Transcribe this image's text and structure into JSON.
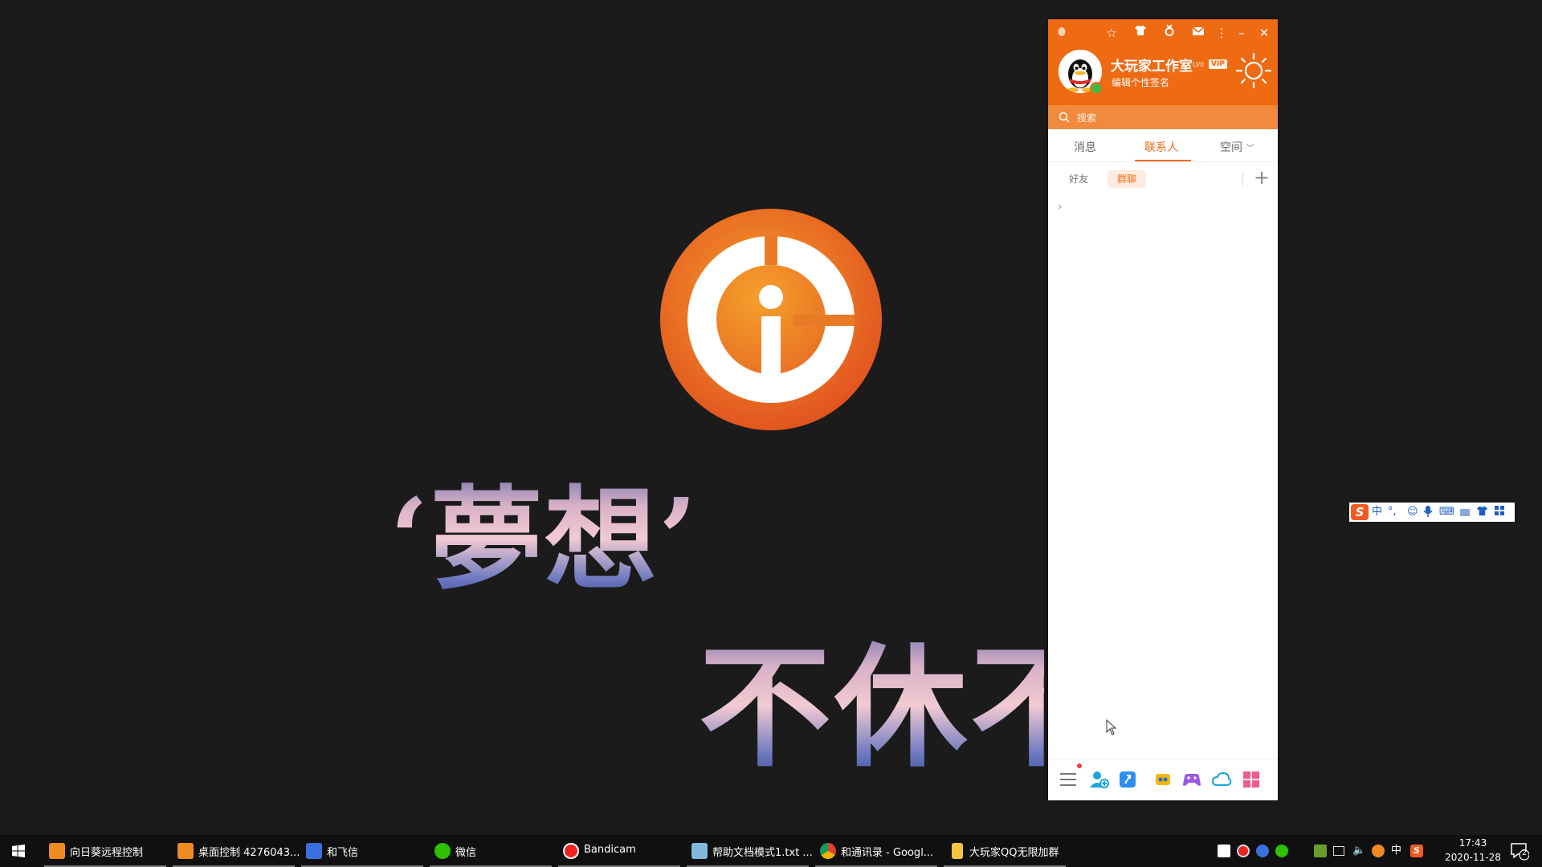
{
  "desktop": {
    "art_line1": "‘夢想’",
    "art_line2": "不休不"
  },
  "qq": {
    "nickname": "大玩家工作室",
    "level": "LV0",
    "vip_badge": "VIP",
    "signature": "编辑个性签名",
    "search_placeholder": "搜索",
    "tabs": [
      {
        "label": "消息"
      },
      {
        "label": "联系人"
      },
      {
        "label": "空间"
      }
    ],
    "subtabs": {
      "friends": "好友",
      "groups": "群聊"
    },
    "accent_color": "#ee6a13"
  },
  "ime": {
    "mode": "中",
    "punct": "°,"
  },
  "taskbar": {
    "items": [
      {
        "label": "向日葵远程控制",
        "icon": "sunflower-icon"
      },
      {
        "label": "桌面控制 4276043...",
        "icon": "sunflower-icon"
      },
      {
        "label": "和飞信",
        "icon": "hefeixin-icon"
      },
      {
        "label": "微信",
        "icon": "wechat-icon"
      },
      {
        "label": "Bandicam",
        "icon": "bandicam-icon"
      },
      {
        "label": "帮助文档模式1.txt ...",
        "icon": "notepad-icon"
      },
      {
        "label": "和通讯录 - Googl...",
        "icon": "chrome-icon"
      },
      {
        "label": "大玩家QQ无限加群",
        "icon": "folder-icon"
      }
    ],
    "tray_lang": "中",
    "time": "17:43",
    "date": "2020-11-28",
    "notification_count": "2"
  }
}
